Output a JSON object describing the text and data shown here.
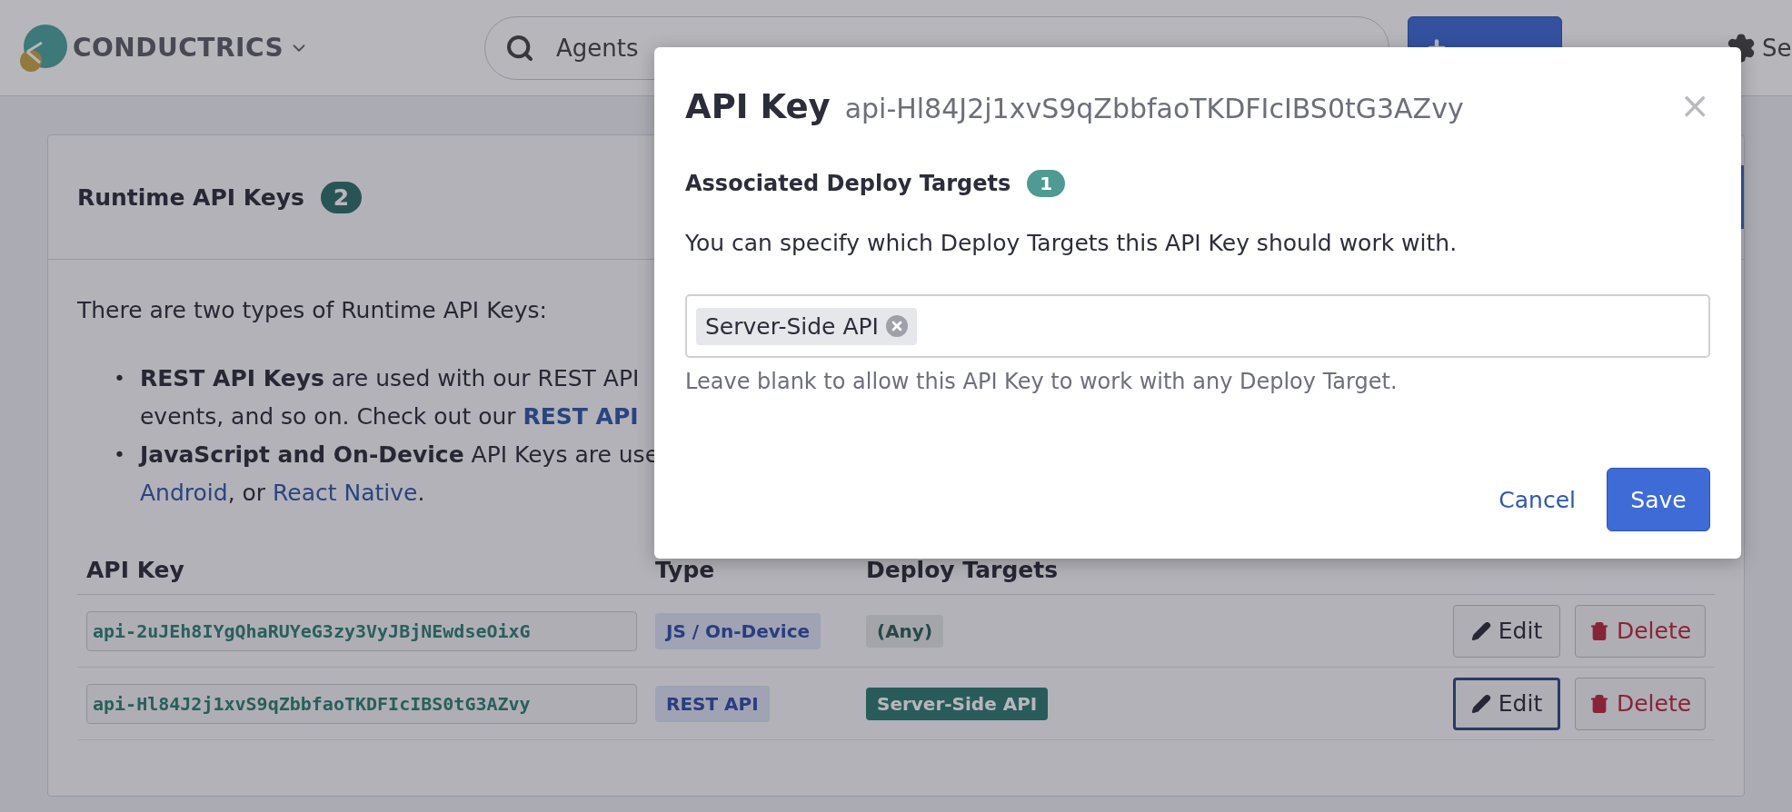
{
  "navbar": {
    "brand": "CONDUCTRICS",
    "search": {
      "value": "Agents"
    },
    "settings_label": "Se"
  },
  "card": {
    "title": "Runtime API Keys",
    "count": "2",
    "intro": "There are two types of Runtime API Keys:",
    "bullets": [
      {
        "marker": "•",
        "line_1": "**REST API Keys** are used with our REST API",
        "line_2": "events, and so on. Check out our",
        "link_1": "REST API"
      },
      {
        "marker": "•",
        "line_1": "**JavaScript and On-Device** API Keys are use",
        "link_1": "Android",
        "line_2": ", or",
        "link_2": "React Native",
        "end": "."
      }
    ],
    "table": {
      "columns": [
        "API Key",
        "Type",
        "Deploy Targets"
      ],
      "rows": [
        {
          "api_key": "api-2uJEh8IYgQhaRUYeG3zy3VyJBjNEwdseOixG",
          "type": "JS / On-Device",
          "target": "(Any)",
          "kind": "any",
          "edit": "Edit",
          "edit_focused": false,
          "delete": "Delete"
        },
        {
          "api_key": "api-Hl84J2j1xvS9qZbbfaoTKDFIcIBS0tG3AZvy",
          "type": "REST API",
          "target": "Server-Side API",
          "kind": "specific",
          "edit": "Edit",
          "edit_focused": true,
          "delete": "Delete"
        }
      ]
    }
  },
  "modal": {
    "title": "API Key",
    "subtitle": "api-Hl84J2j1xvS9qZbbfaoTKDFIcIBS0tG3AZvy",
    "close": "×",
    "section_title": "Associated Deploy Targets",
    "section_count": "1",
    "description": "You can specify which Deploy Targets this API Key should work with.",
    "tags": [
      "Server-Side API"
    ],
    "help": "Leave blank to allow this API Key to work with any Deploy Target.",
    "cancel": "Cancel",
    "save": "Save"
  }
}
